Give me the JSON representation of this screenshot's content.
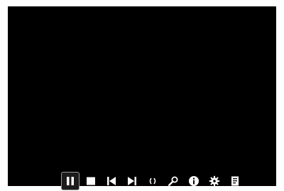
{
  "player": {
    "background_color": "#000000",
    "controls": [
      {
        "icon": "pause-icon",
        "state": "active"
      },
      {
        "icon": "stop-icon"
      },
      {
        "icon": "skip-previous-icon"
      },
      {
        "icon": "skip-next-icon"
      },
      {
        "icon": "loop-icon"
      },
      {
        "icon": "zoom-icon"
      },
      {
        "icon": "info-icon"
      },
      {
        "icon": "settings-gear-icon"
      },
      {
        "icon": "playlist-icon"
      }
    ]
  }
}
